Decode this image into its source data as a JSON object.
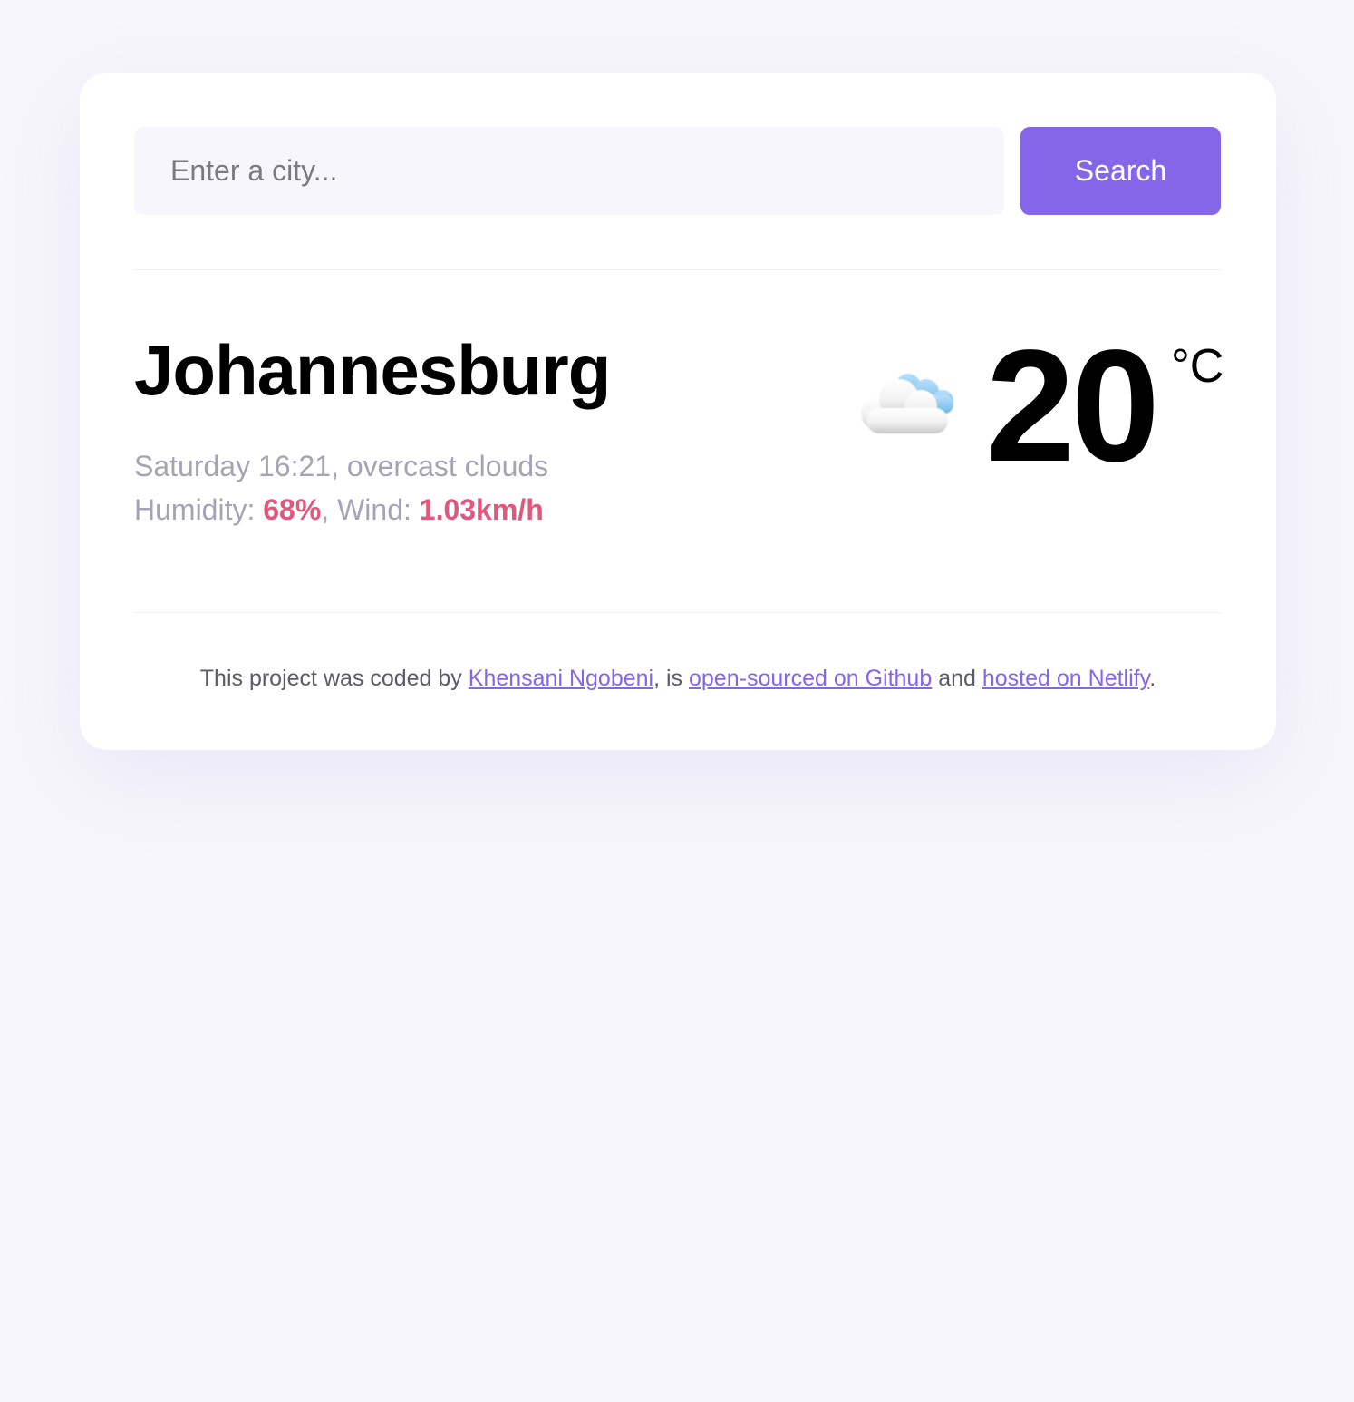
{
  "search": {
    "placeholder": "Enter a city...",
    "button_label": "Search"
  },
  "weather": {
    "city": "Johannesburg",
    "day_time": "Saturday 16:21",
    "description": "overcast clouds",
    "humidity_label": "Humidity:",
    "humidity": "68%",
    "wind_label": "Wind:",
    "wind": "1.03km/h",
    "icon": "cloud-icon",
    "temperature": "20",
    "unit": "°C"
  },
  "footer": {
    "prefix": "This project was coded by",
    "author_link": "Khensani Ngobeni",
    "mid1": ", is",
    "github_link": "open-sourced on Github",
    "mid2": "and",
    "netlify_link": "hosted on Netlify",
    "suffix": "."
  },
  "colors": {
    "accent": "#8566e8",
    "highlight": "#e2577e",
    "background": "#f7f6fc",
    "muted_text": "#a5a4b4"
  }
}
